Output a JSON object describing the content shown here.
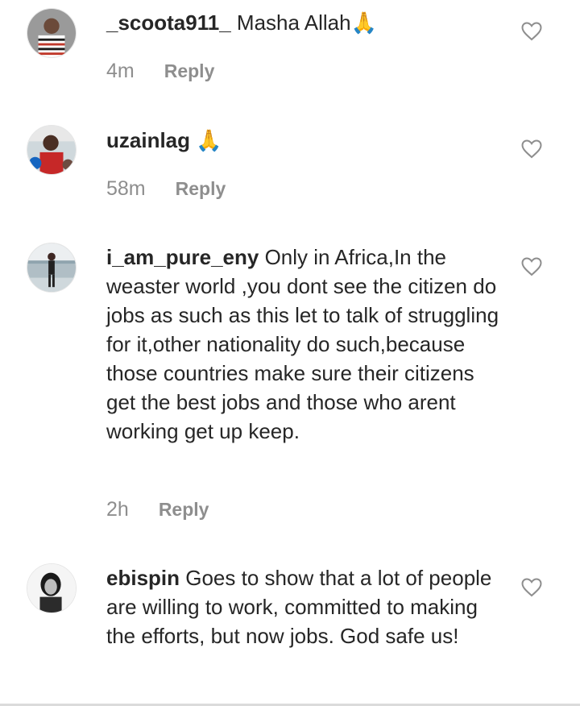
{
  "comments": [
    {
      "username": "_scoota911_",
      "text": "Masha Allah🙏",
      "time": "4m",
      "reply_label": "Reply",
      "avatar_icon": "avatar-photo-striped-shirt",
      "like_icon": "heart-outline-icon"
    },
    {
      "username": "uzainlag",
      "text": "🙏",
      "time": "58m",
      "reply_label": "Reply",
      "avatar_icon": "avatar-photo-red-outfit",
      "like_icon": "heart-outline-icon"
    },
    {
      "username": "i_am_pure_eny",
      "text": "Only in Africa,In the weaster world ,you dont see the citizen do jobs as such as this let to talk of struggling for it,other nationality do such,because those countries make sure their citizens get the best jobs and those who arent working get up keep.",
      "time": "2h",
      "reply_label": "Reply",
      "avatar_icon": "avatar-photo-standing-figure",
      "like_icon": "heart-outline-icon"
    },
    {
      "username": "ebispin",
      "text": "Goes to show that a lot of people are willing to work, committed to making the efforts, but now jobs. God safe us!",
      "time": "",
      "reply_label": "",
      "avatar_icon": "avatar-photo-black-and-white",
      "like_icon": "heart-outline-icon"
    }
  ],
  "colors": {
    "text": "#262626",
    "muted": "#8e8e8e",
    "divider": "#dbdbdb"
  }
}
